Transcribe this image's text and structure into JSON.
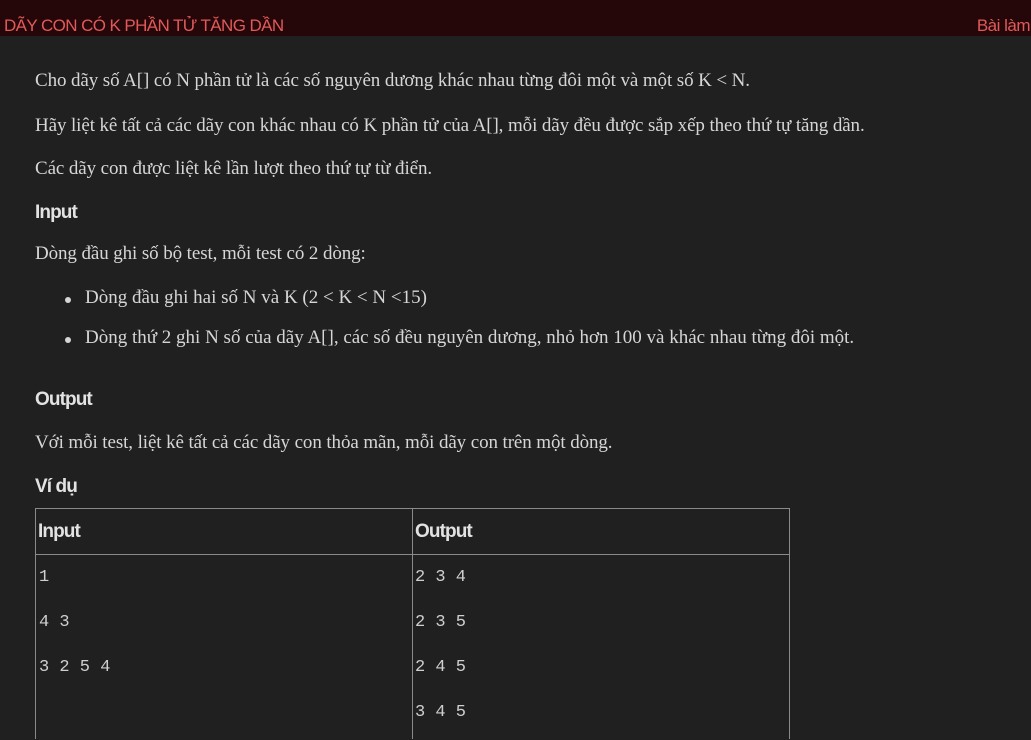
{
  "header": {
    "title": "DÃY CON CÓ K PHẦN TỬ TĂNG DẦN",
    "submit_label": "Bài làm"
  },
  "problem": {
    "paragraphs": [
      "Cho dãy số A[] có N phần tử là các số nguyên dương khác nhau từng đôi một và một số K < N.",
      "Hãy liệt kê tất cả các dãy con khác nhau có K phần tử của A[], mỗi dãy đều được sắp xếp theo thứ tự tăng dần.",
      "Các dãy con được liệt kê lần lượt theo thứ tự từ điển."
    ],
    "input_heading": "Input",
    "input_text": "Dòng đầu ghi số bộ test, mỗi test có 2 dòng:",
    "input_items": [
      "Dòng đầu ghi hai số N và K (2 < K < N <15)",
      "Dòng thứ 2 ghi N số của dãy A[], các số đều nguyên dương, nhỏ hơn 100 và khác nhau từng đôi một."
    ],
    "output_heading": "Output",
    "output_text": "Với mỗi test, liệt kê tất cả các dãy con thỏa mãn, mỗi dãy con trên một dòng.",
    "example_heading": "Ví dụ"
  },
  "example_table": {
    "headers": [
      "Input",
      "Output"
    ],
    "input_lines": [
      "1",
      "4 3",
      "3 2 5 4"
    ],
    "output_lines": [
      "2 3 4",
      "2 3 5",
      "2 4 5",
      "3 4 5"
    ]
  },
  "colors": {
    "header_bg": "#260709",
    "header_text": "#e05a5a",
    "content_bg": "#202020",
    "text": "#d6d6d6"
  }
}
